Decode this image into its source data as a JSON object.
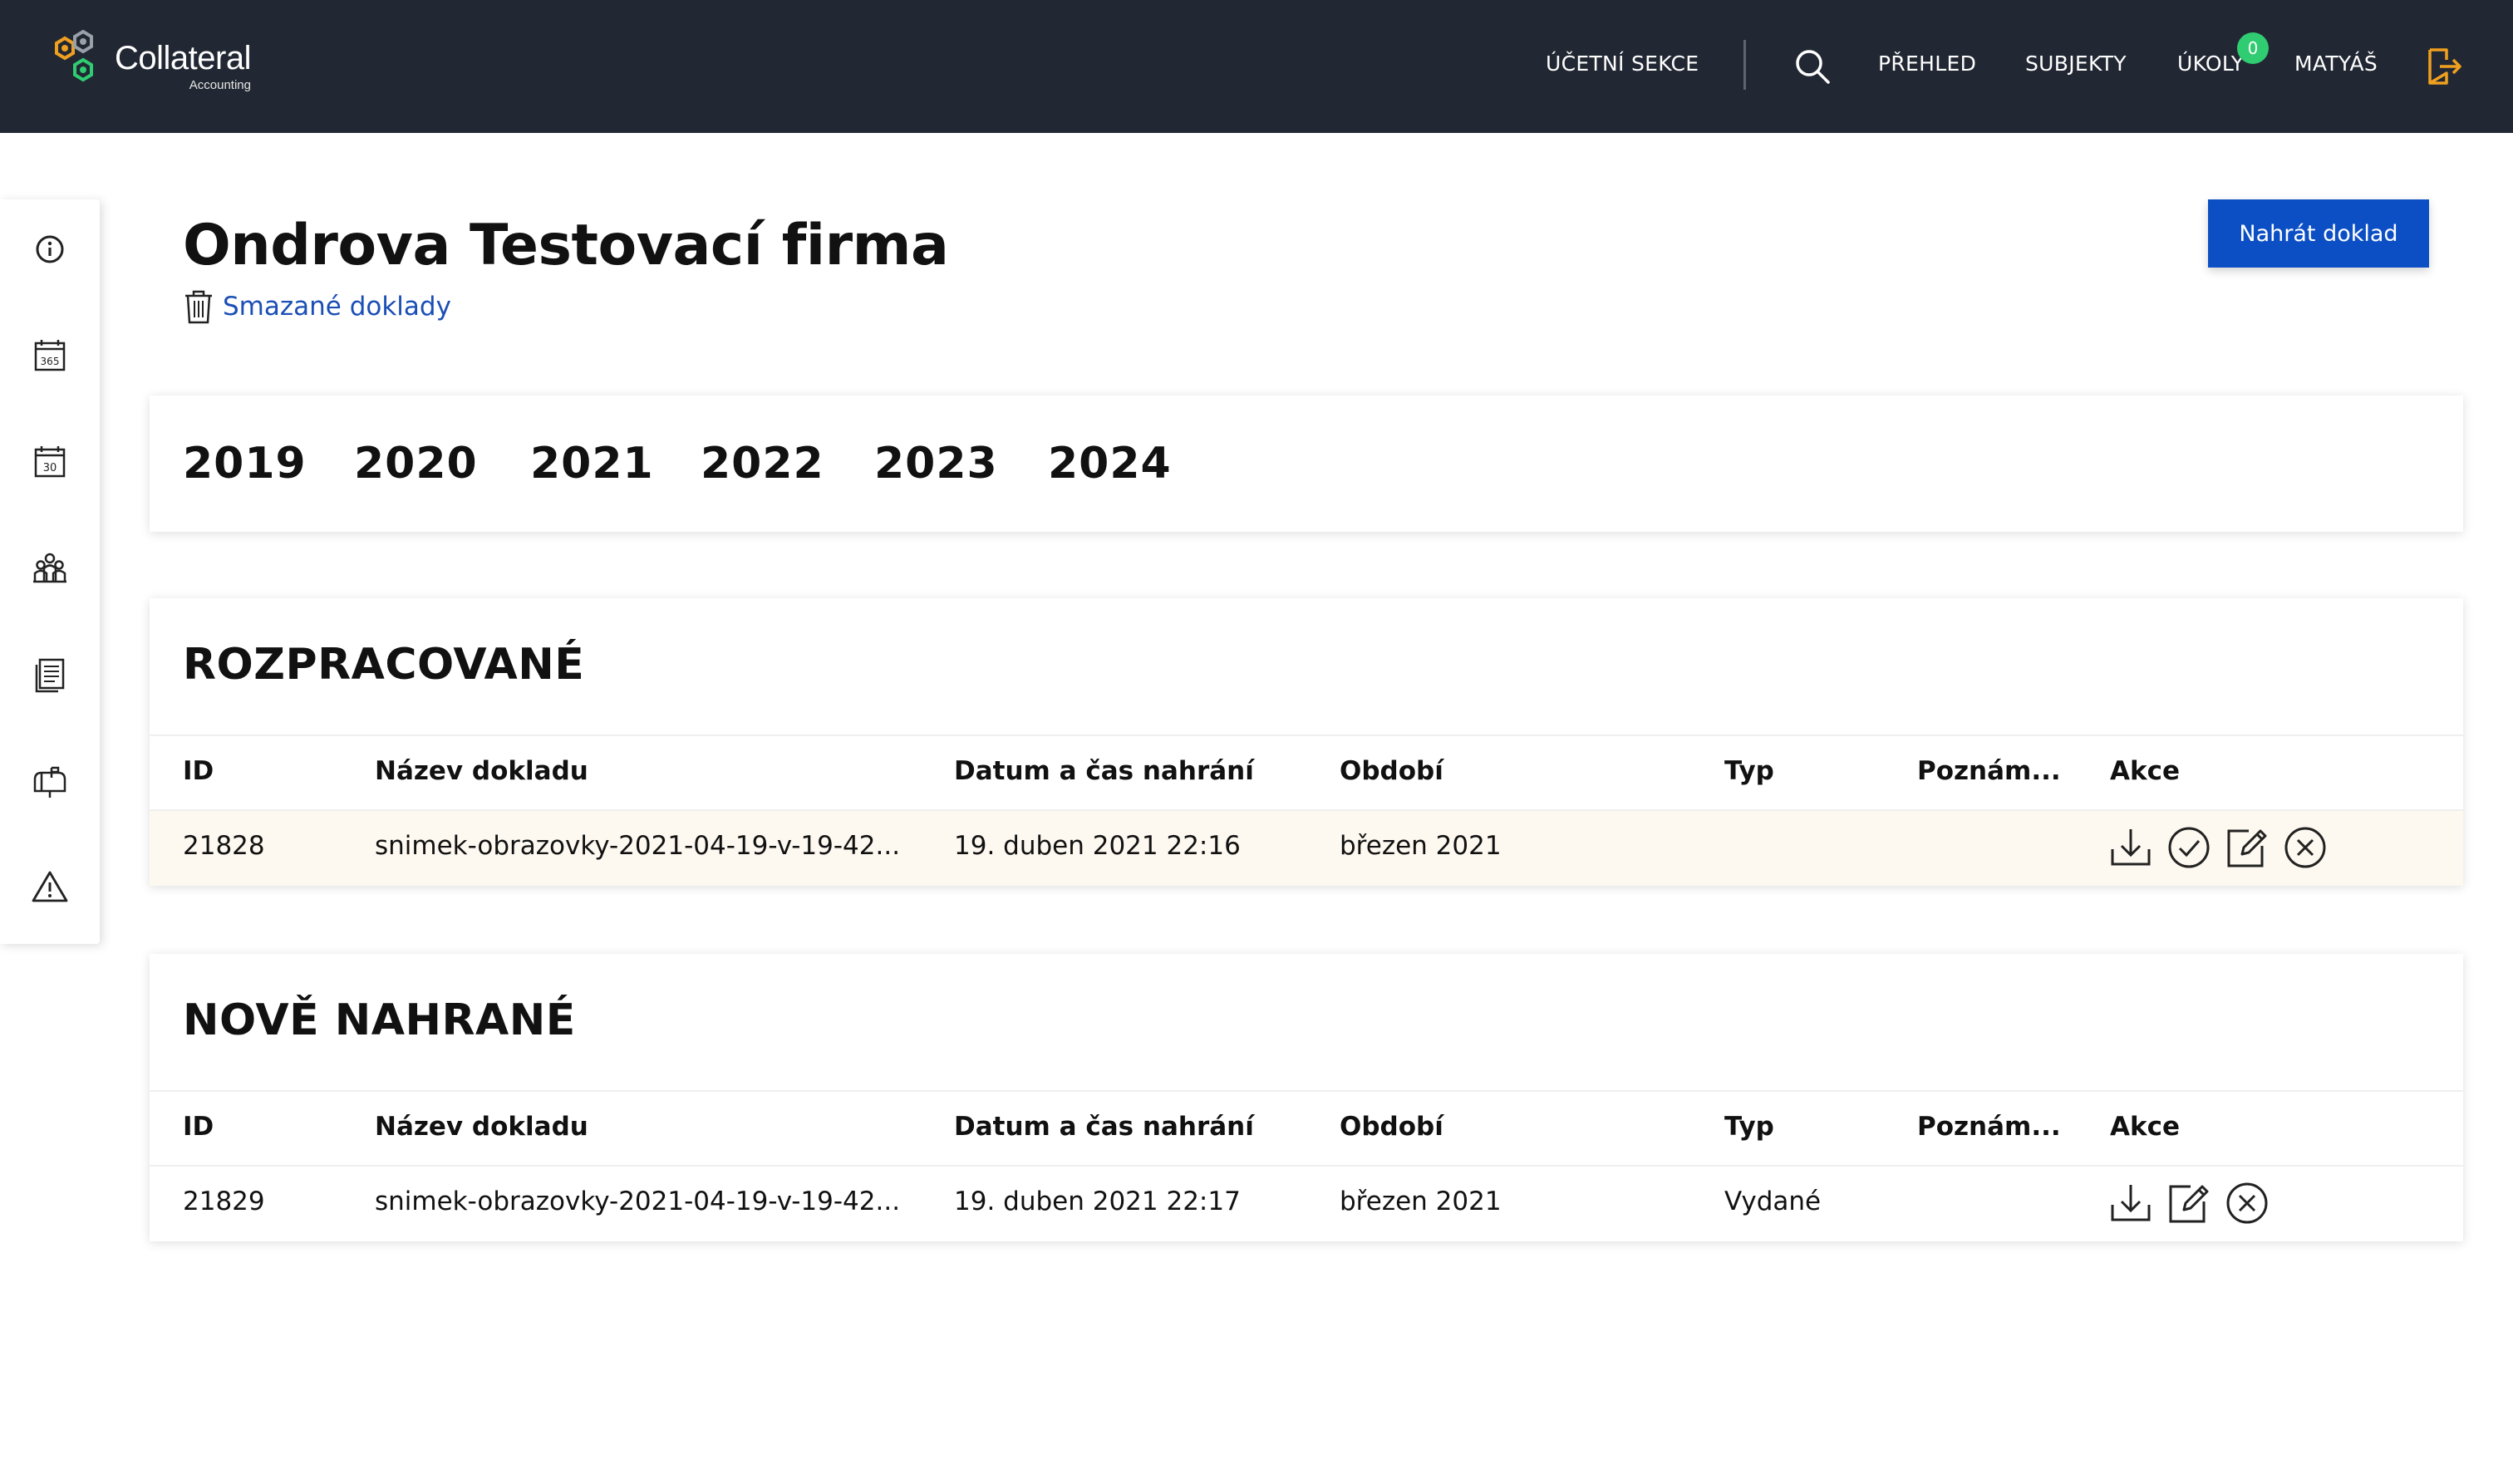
{
  "app": {
    "logo_name": "Collateral",
    "logo_sub": "Accounting"
  },
  "nav": {
    "accounting_section": "ÚČETNÍ SEKCE",
    "overview": "PŘEHLED",
    "subjects": "SUBJEKTY",
    "tasks": "ÚKOLY",
    "tasks_count": "0",
    "user": "MATYÁŠ"
  },
  "sidebar": {
    "items": [
      "info-icon",
      "calendar-365-icon",
      "calendar-30-icon",
      "people-group-icon",
      "documents-icon",
      "mailbox-icon",
      "warning-icon"
    ]
  },
  "page": {
    "title": "Ondrova Testovací firma",
    "deleted_link": "Smazané doklady",
    "upload_button": "Nahrát doklad"
  },
  "years": [
    "2019",
    "2020",
    "2021",
    "2022",
    "2023",
    "2024"
  ],
  "columns": [
    "ID",
    "Název dokladu",
    "Datum a čas nahrání",
    "Období",
    "Typ",
    "Poznám...",
    "Akce"
  ],
  "in_progress": {
    "title": "ROZPRACOVANÉ",
    "rows": [
      {
        "id": "21828",
        "name": "snimek-obrazovky-2021-04-19-v-19-42...",
        "uploaded": "19. duben 2021 22:16",
        "period": "březen 2021",
        "type": "",
        "note": "",
        "actions": [
          "download-icon",
          "check-circle-icon",
          "edit-icon",
          "close-circle-icon"
        ]
      }
    ]
  },
  "newly_uploaded": {
    "title": "NOVĚ NAHRANÉ",
    "rows": [
      {
        "id": "21829",
        "name": "snimek-obrazovky-2021-04-19-v-19-42...",
        "uploaded": "19. duben 2021 22:17",
        "period": "březen 2021",
        "type": "Vydané",
        "note": "",
        "actions": [
          "download-icon",
          "edit-icon",
          "close-circle-icon"
        ]
      }
    ]
  },
  "colors": {
    "topbar": "#222833",
    "primary": "#0c4fc4",
    "link": "#1b4fb5",
    "badge": "#2fcc71",
    "exit_icon": "#f0a020",
    "highlight_row": "#fdf9f0"
  }
}
